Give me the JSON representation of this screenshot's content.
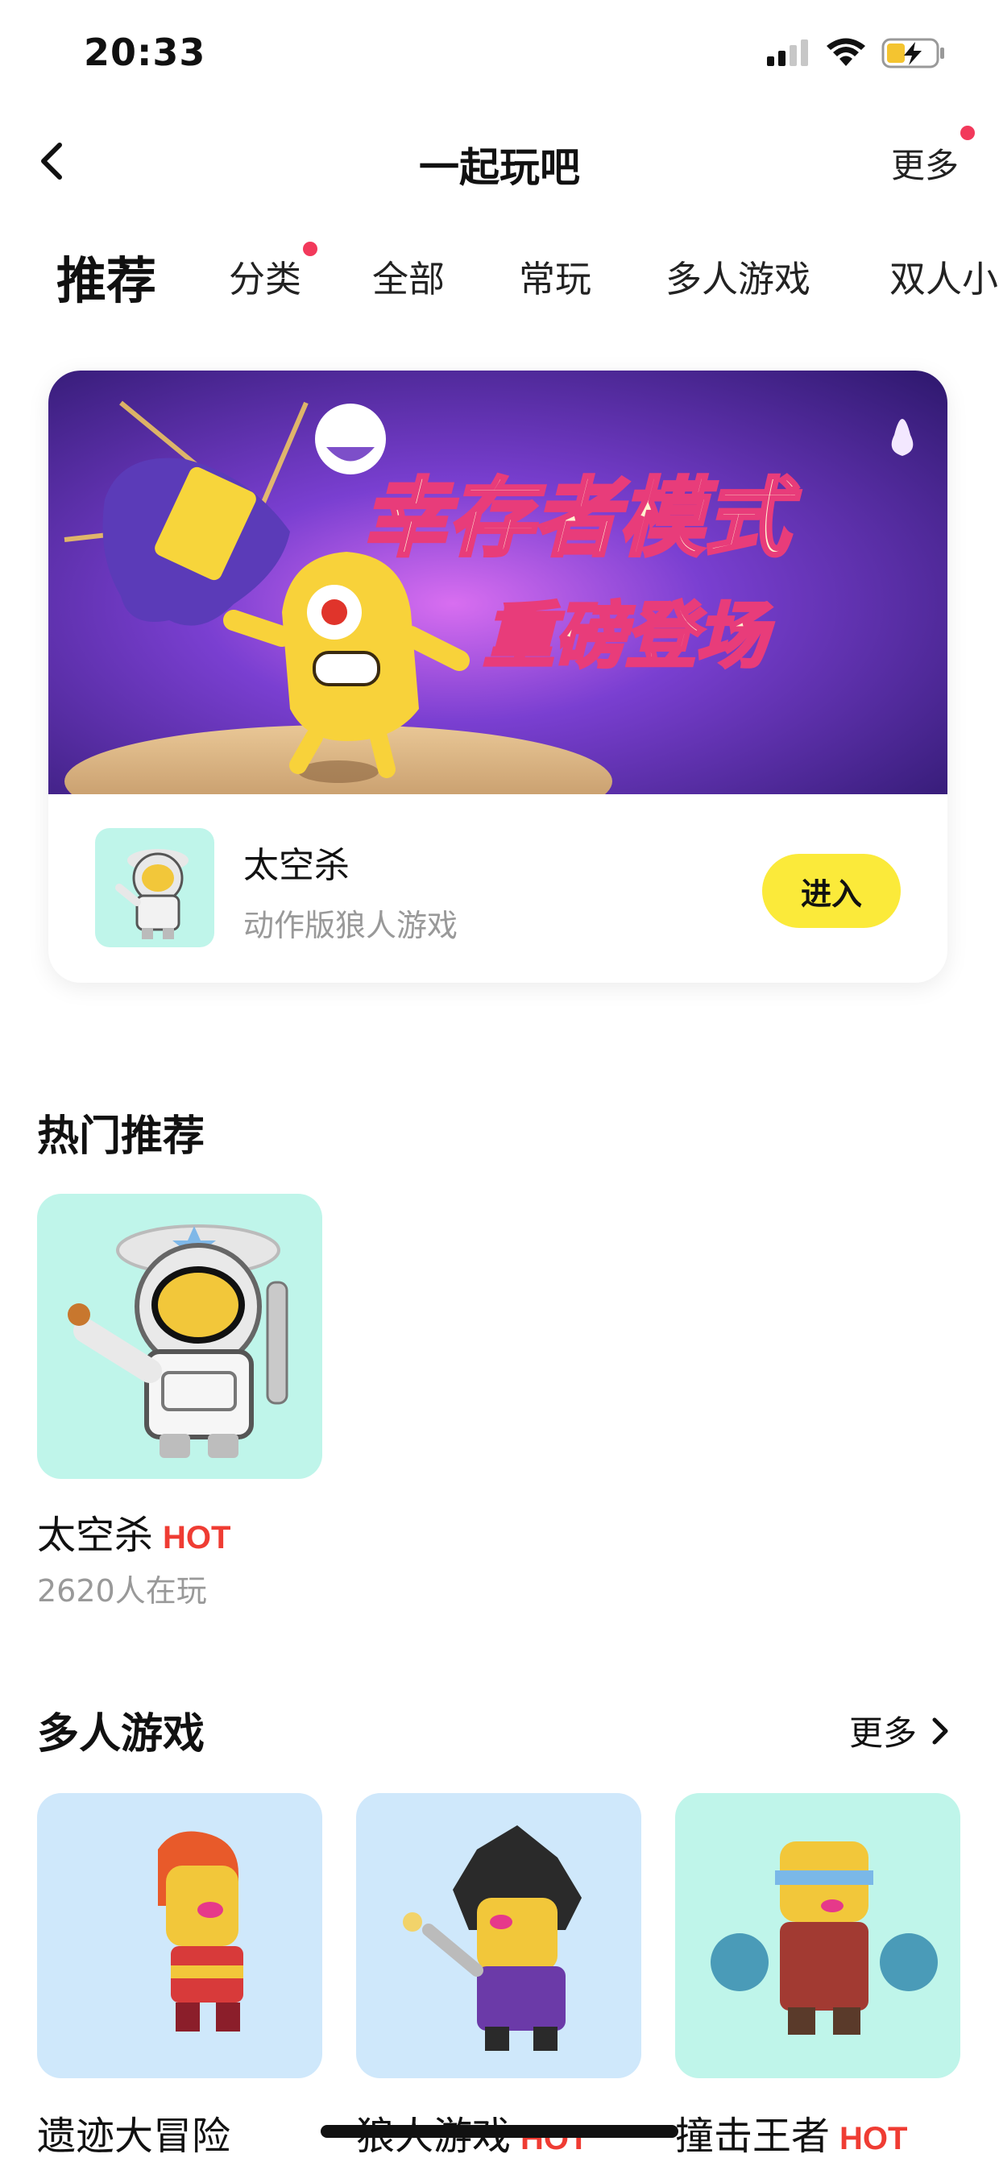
{
  "status_bar": {
    "time": "20:33"
  },
  "nav": {
    "title": "一起玩吧",
    "more_label": "更多"
  },
  "tabs": [
    "推荐",
    "分类",
    "全部",
    "常玩",
    "多人游戏",
    "双人小"
  ],
  "banner": {
    "headline_line1": "幸存者模式",
    "headline_line2": "重磅登场",
    "game_title": "太空杀",
    "game_subtitle": "动作版狼人游戏",
    "enter_label": "进入"
  },
  "hot_section": {
    "title": "热门推荐",
    "items": [
      {
        "name": "太空杀",
        "badge": "HOT",
        "players": "2620人在玩"
      }
    ]
  },
  "multi_section": {
    "title": "多人游戏",
    "more_label": "更多",
    "items": [
      {
        "name": "遗迹大冒险",
        "badge": ""
      },
      {
        "name": "狼人游戏",
        "badge": "HOT"
      },
      {
        "name": "撞击王者",
        "badge": "HOT"
      }
    ]
  },
  "colors": {
    "accent_yellow": "#fbea3a",
    "hot_red": "#ef3c33",
    "dot_red": "#f2395b",
    "tile_mint": "#bff5ea",
    "tile_blue": "#cfe8fb"
  }
}
